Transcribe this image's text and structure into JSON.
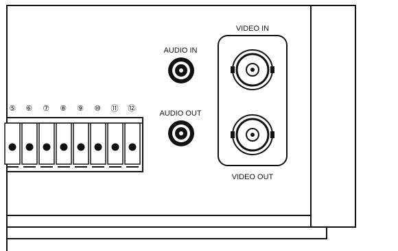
{
  "panel": {
    "audio_in_label": "AUDIO IN",
    "audio_out_label": "AUDIO OUT",
    "video_in_label": "VIDEO IN",
    "video_out_label": "VIDEO OUT"
  },
  "terminal_block": {
    "numbers": [
      "⑤",
      "⑥",
      "⑦",
      "⑧",
      "⑨",
      "⑩",
      "⑪",
      "⑫"
    ]
  },
  "colors": {
    "line": "#111111",
    "background": "#ffffff"
  }
}
